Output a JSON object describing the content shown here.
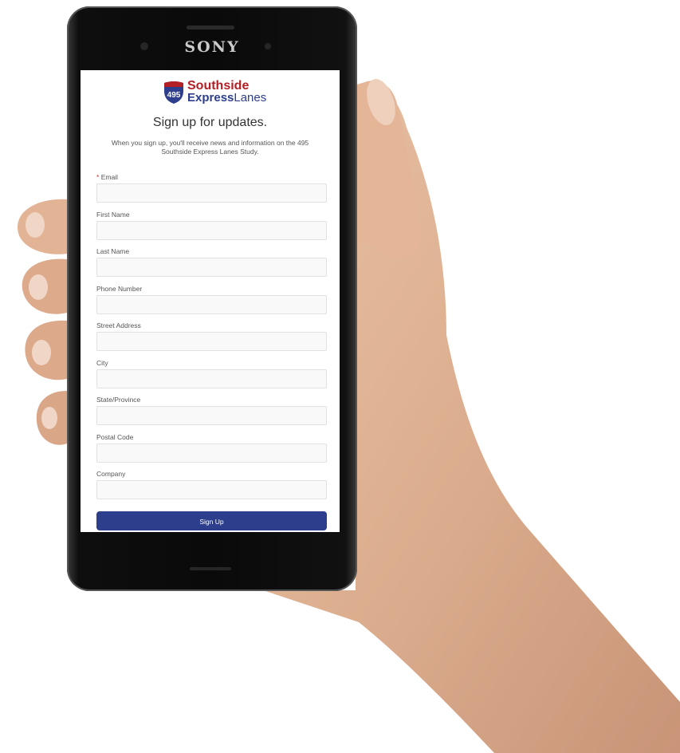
{
  "device": {
    "brand": "SONY"
  },
  "logo": {
    "shield_number": "495",
    "line1": "Southside",
    "line2_bold": "Express",
    "line2_rest": "Lanes"
  },
  "page": {
    "headline": "Sign up for updates.",
    "intro": "When you sign up, you'll receive news and information on the 495 Southside Express Lanes Study."
  },
  "form": {
    "required_marker": "*",
    "fields": [
      {
        "label": "Email",
        "required": true,
        "value": ""
      },
      {
        "label": "First Name",
        "value": ""
      },
      {
        "label": "Last Name",
        "value": ""
      },
      {
        "label": "Phone Number",
        "value": ""
      },
      {
        "label": "Street Address",
        "value": ""
      },
      {
        "label": "City",
        "value": ""
      },
      {
        "label": "State/Province",
        "value": ""
      },
      {
        "label": "Postal Code",
        "value": ""
      },
      {
        "label": "Company",
        "value": ""
      }
    ],
    "submit_label": "Sign Up"
  },
  "colors": {
    "brand_red": "#b31f24",
    "brand_blue": "#2c3e8c",
    "button": "#2c3e8c"
  }
}
